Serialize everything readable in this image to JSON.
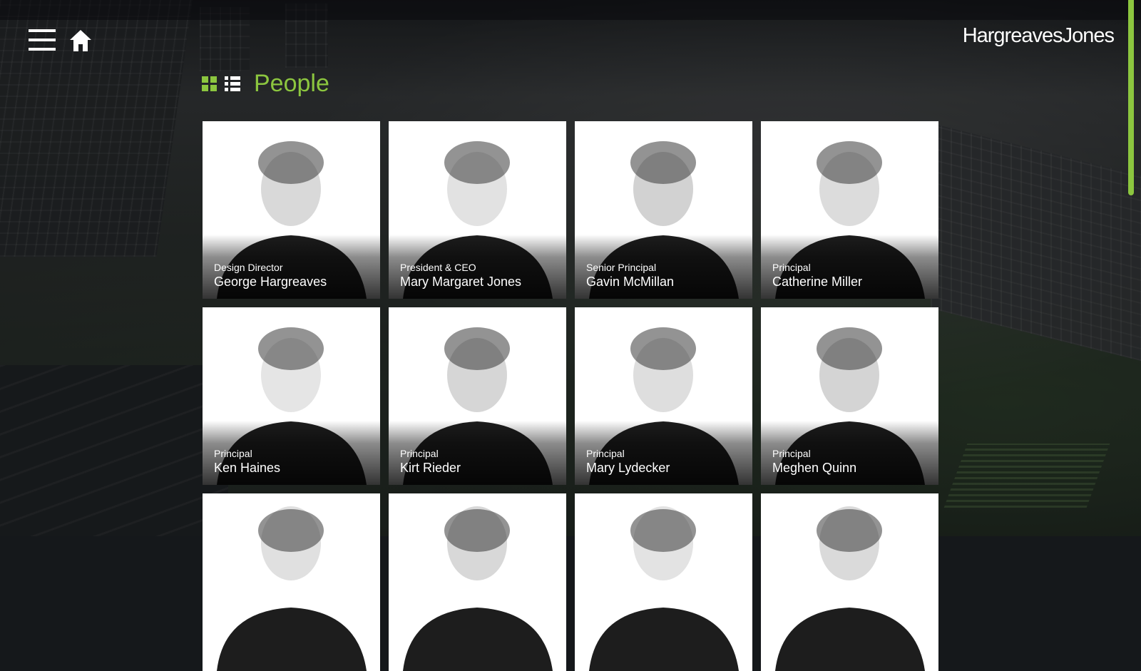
{
  "header": {
    "logo_text": "HargreavesJones",
    "menu_icon": "hamburger-menu-icon",
    "home_icon": "home-icon"
  },
  "page": {
    "title": "People",
    "grid_view_icon": "grid-view-icon",
    "list_view_icon": "list-view-icon"
  },
  "colors": {
    "accent": "#8cc63f",
    "text": "#ffffff"
  },
  "people": [
    {
      "role": "Design Director",
      "name": "George Hargreaves"
    },
    {
      "role": "President & CEO",
      "name": "Mary Margaret Jones"
    },
    {
      "role": "Senior Principal",
      "name": "Gavin McMillan"
    },
    {
      "role": "Principal",
      "name": "Catherine Miller"
    },
    {
      "role": "Principal",
      "name": "Ken Haines"
    },
    {
      "role": "Principal",
      "name": "Kirt Rieder"
    },
    {
      "role": "Principal",
      "name": "Mary Lydecker"
    },
    {
      "role": "Principal",
      "name": "Meghen Quinn"
    },
    {
      "role": "",
      "name": ""
    },
    {
      "role": "",
      "name": ""
    },
    {
      "role": "",
      "name": ""
    },
    {
      "role": "",
      "name": ""
    }
  ]
}
